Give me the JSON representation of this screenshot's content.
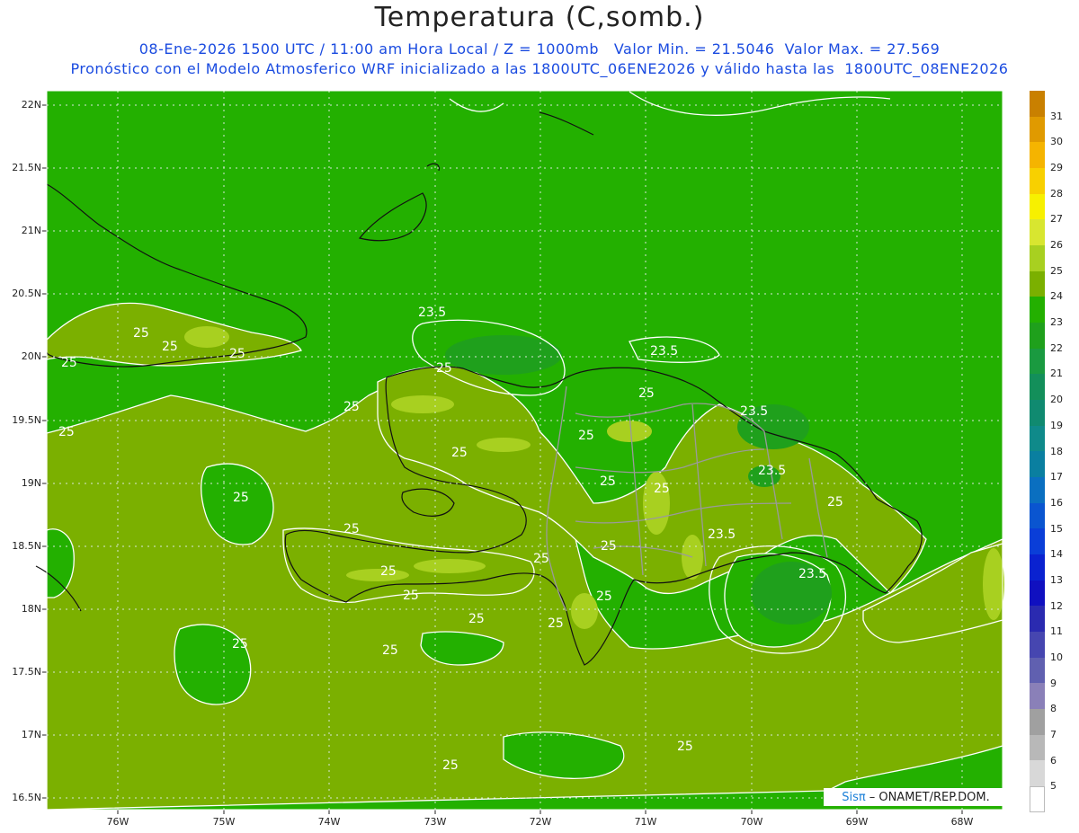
{
  "title": "Temperatura (C,somb.)",
  "subtitle_line1": "08-Ene-2026 1500 UTC / 11:00 am Hora Local / Z = 1000mb   Valor Min. = 21.5046  Valor Max. = 27.569",
  "subtitle_line2": "Pronóstico con el Modelo Atmosferico WRF inicializado a las 1800UTC_06ENE2026 y válido hasta las  1800UTC_08ENE2026",
  "lat_labels": [
    "22N",
    "21.5N",
    "21N",
    "20.5N",
    "20N",
    "19.5N",
    "19N",
    "18.5N",
    "18N",
    "17.5N",
    "17N",
    "16.5N"
  ],
  "lon_labels": [
    "76W",
    "75W",
    "74W",
    "73W",
    "72W",
    "71W",
    "70W",
    "69W",
    "68W"
  ],
  "contour_labels": [
    "23.5",
    "23.5",
    "23.5",
    "23.5",
    "23.5",
    "23.5",
    "25",
    "25",
    "25",
    "25",
    "25",
    "25",
    "25",
    "25",
    "25",
    "25",
    "25",
    "25",
    "25",
    "25",
    "25",
    "25",
    "25",
    "25",
    "25",
    "25",
    "25"
  ],
  "colorbar": {
    "labels": [
      "31",
      "30",
      "29",
      "28",
      "27",
      "26",
      "25",
      "24",
      "23",
      "22",
      "21",
      "20",
      "19",
      "18",
      "17",
      "16",
      "15",
      "14",
      "13",
      "12",
      "11",
      "10",
      "9",
      "8",
      "7",
      "6",
      "5"
    ],
    "colors": [
      "#c98000",
      "#e09a00",
      "#f5b400",
      "#f8d000",
      "#f7f000",
      "#d8e630",
      "#a8d020",
      "#7bb000",
      "#23b000",
      "#1fa01c",
      "#1a9a40",
      "#138f5a",
      "#108a70",
      "#0f8a8a",
      "#0a7fa0",
      "#0a6fc0",
      "#0a55d0",
      "#0a3ed8",
      "#0a22d0",
      "#1010c0",
      "#2a2ab0",
      "#4646b0",
      "#6060b0",
      "#8a80b8",
      "#a0a0a0",
      "#b8b8b8",
      "#d8d8d8",
      "#ffffff"
    ]
  },
  "colors": {
    "green_24": "#23b000",
    "olive_25": "#7bb000",
    "light_26": "#a8d020",
    "teal_23": "#1fa01c",
    "title_blue": "#1a4be0"
  },
  "credit": {
    "brand": "Sisπ",
    "text": "– ONAMET/REP.DOM."
  }
}
